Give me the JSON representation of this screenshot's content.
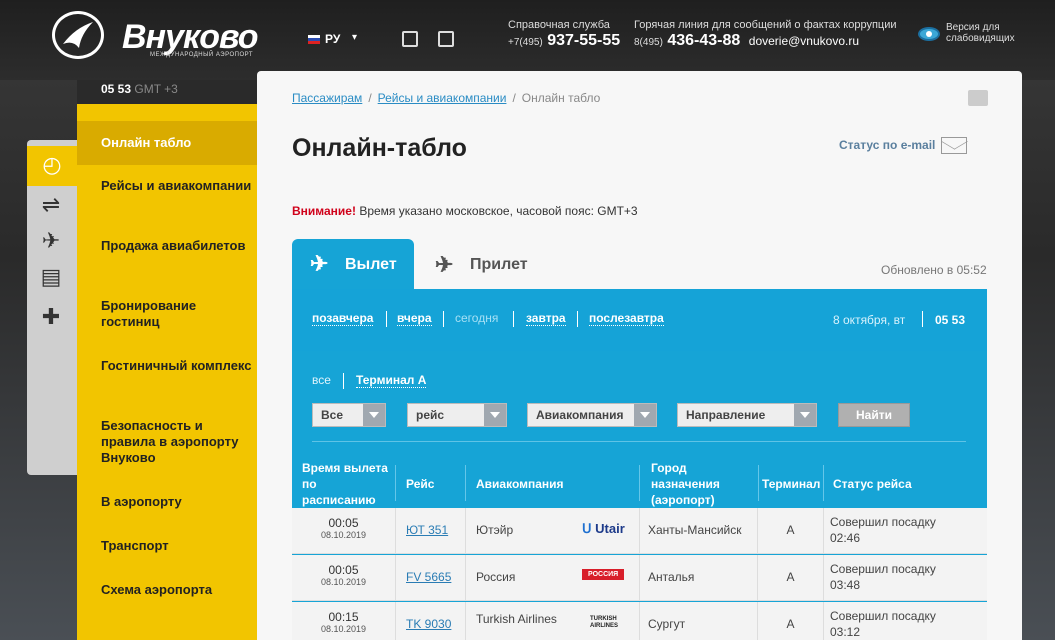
{
  "header": {
    "logo_text": "Внуково",
    "logo_sub": "МЕЖДУНАРОДНЫЙ АЭРОПОРТ",
    "language": "РУ",
    "help_label": "Справочная служба",
    "help_code": "+7(495)",
    "help_number": "937-55-55",
    "hotline_label": "Горячая линия для сообщений о фактах коррупции",
    "hotline_code": "8(495)",
    "hotline_number": "436-43-88",
    "hotline_email": "doverie@vnukovo.ru",
    "accessibility_line1": "Версия для",
    "accessibility_line2": "слабовидящих"
  },
  "clock": {
    "time": "05 53",
    "gmt": "GMT +3"
  },
  "sidebar": {
    "items": [
      "Онлайн табло",
      "Рейсы и авиакомпании",
      "Продажа авиабилетов",
      "Бронирование гостиниц",
      "Гостиничный комплекс",
      "Безопасность и правила в аэропорту Внуково",
      "В аэропорту",
      "Транспорт",
      "Схема аэропорта"
    ]
  },
  "breadcrumb": {
    "item1": "Пассажирам",
    "item2": "Рейсы и авиакомпании",
    "current": "Онлайн табло"
  },
  "page": {
    "title": "Онлайн-табло",
    "email_status": "Статус по e-mail",
    "warning_label": "Внимание!",
    "warning_text": " Время указано московское, часовой пояс: GMT+3"
  },
  "tabs": {
    "departure": "Вылет",
    "arrival": "Прилет",
    "updated": "Обновлено в 05:52"
  },
  "days": {
    "d1": "позавчера",
    "d2": "вчера",
    "d3": "сегодня",
    "d4": "завтра",
    "d5": "послезавтра",
    "date": "8 октября, вт",
    "time": "05 53"
  },
  "filters": {
    "all": "все",
    "terminal": "Терминал А",
    "select_all": "Все",
    "select_flight": "рейс",
    "select_airline": "Авиакомпания",
    "select_direction": "Направление",
    "find": "Найти"
  },
  "table": {
    "headers": {
      "time": "Время вылета по расписанию",
      "flight": "Рейс",
      "airline": "Авиакомпания",
      "dest": "Город назначения (аэропорт)",
      "terminal": "Терминал",
      "status": "Статус рейса"
    },
    "rows": [
      {
        "time": "00:05",
        "date": "08.10.2019",
        "flight": "ЮТ 351",
        "airline": "Ютэйр",
        "logo": "Utair",
        "dest": "Ханты-Мансийск",
        "terminal": "А",
        "status1": "Совершил посадку",
        "status2": "02:46"
      },
      {
        "time": "00:05",
        "date": "08.10.2019",
        "flight": "FV 5665",
        "airline": "Россия",
        "logo": "РОССИЯ",
        "dest": "Анталья",
        "terminal": "А",
        "status1": "Совершил посадку",
        "status2": "03:48"
      },
      {
        "time": "00:15",
        "date": "08.10.2019",
        "flight": "TK 9030",
        "airline": "Turkish Airlines",
        "logo": "TURKISH AIRLINES",
        "dest": "Сургут",
        "terminal": "А",
        "status1": "Совершил посадку",
        "status2": "03:12"
      }
    ]
  },
  "colors": {
    "accent_blue": "#16a4d6",
    "sidebar_yellow": "#f2c500",
    "warning_red": "#d0021b"
  },
  "icons": [
    "logo-bird-icon",
    "print-icon",
    "envelope-icon",
    "eye-icon",
    "departure-plane-icon",
    "arrival-plane-icon"
  ]
}
